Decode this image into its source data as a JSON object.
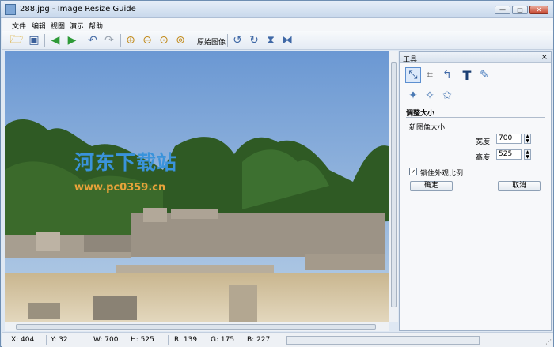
{
  "window": {
    "title": "288.jpg - Image Resize Guide",
    "min": "—",
    "max": "□",
    "close": "✕"
  },
  "menu": [
    "文件",
    "编辑",
    "视图",
    "演示",
    "帮助"
  ],
  "toolbar": {
    "original_image": "原始图像"
  },
  "watermark": {
    "text": "河东下载站",
    "url": "www.pc0359.cn"
  },
  "panel": {
    "title": "工具",
    "close": "×",
    "section": "调整大小",
    "new_size_label": "新图像大小:",
    "width_label": "宽度:",
    "width_value": "700",
    "height_label": "高度:",
    "height_value": "525",
    "keep_ratio_label": "锁住外观比例",
    "keep_ratio_checked": "✓",
    "ok": "确定",
    "cancel": "取消"
  },
  "status": {
    "x": "X: 404",
    "y": "Y: 32",
    "w": "W: 700",
    "h": "H: 525",
    "r": "R: 139",
    "g": "G: 175",
    "b": "B: 227"
  }
}
